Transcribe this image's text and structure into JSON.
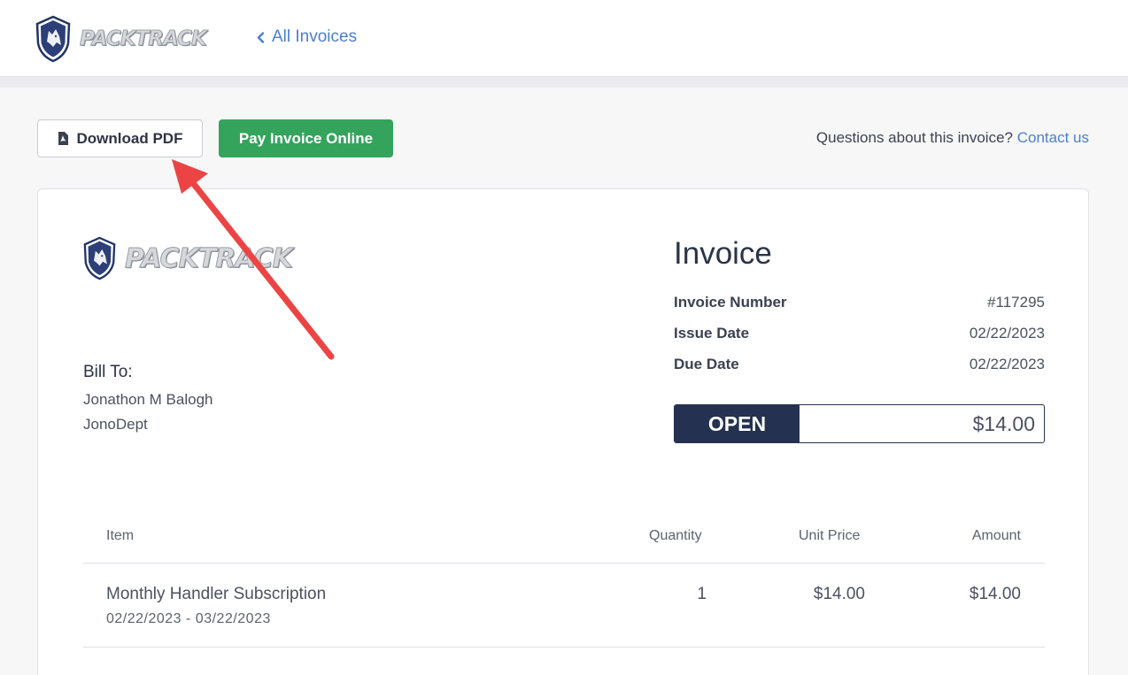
{
  "header": {
    "brand_name": "PACKTRACK",
    "back_link_label": "All Invoices"
  },
  "actions": {
    "download_label": "Download PDF",
    "pay_label": "Pay Invoice Online",
    "questions_text": "Questions about this invoice?",
    "contact_label": "Contact us"
  },
  "invoice": {
    "brand_name": "PACKTRACK",
    "title": "Invoice",
    "bill_to_title": "Bill To:",
    "bill_to_name": "Jonathon M Balogh",
    "bill_to_dept": "JonoDept",
    "meta": [
      {
        "label": "Invoice Number",
        "value": "#117295"
      },
      {
        "label": "Issue Date",
        "value": "02/22/2023"
      },
      {
        "label": "Due Date",
        "value": "02/22/2023"
      }
    ],
    "status": "OPEN",
    "balance": "$14.00"
  },
  "table": {
    "headers": [
      "Item",
      "Quantity",
      "Unit Price",
      "Amount"
    ],
    "rows": [
      {
        "item": "Monthly Handler Subscription",
        "period": "02/22/2023 - 03/22/2023",
        "quantity": "1",
        "unit_price": "$14.00",
        "amount": "$14.00"
      }
    ]
  },
  "colors": {
    "accent_link": "#4b7fd1",
    "pay_button": "#34a45d",
    "status_navy": "#243150",
    "annotation_arrow": "#ec4444"
  },
  "icons": {
    "logo": "shield-wolf-icon",
    "back": "chevron-left-icon",
    "pdf": "pdf-file-icon"
  }
}
